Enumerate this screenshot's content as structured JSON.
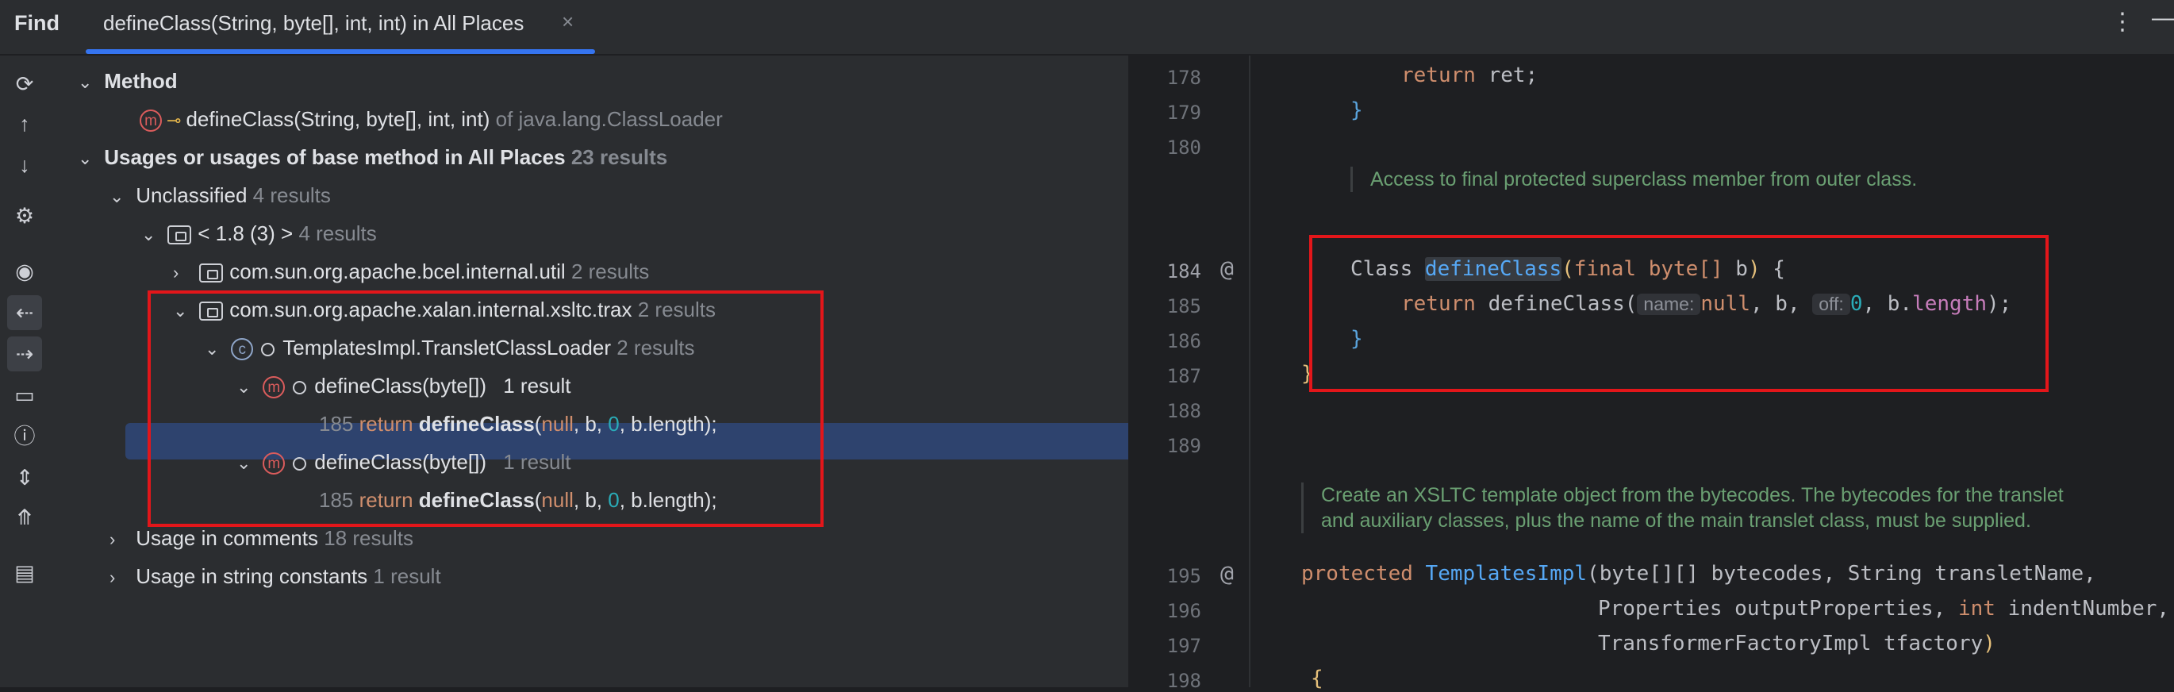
{
  "header": {
    "find_label": "Find",
    "tab_label": "defineClass(String, byte[], int, int) in All Places",
    "close_glyph": "×",
    "more_glyph": "⋮",
    "minimize_glyph": "—"
  },
  "toolbar": {
    "icons": [
      "refresh-icon",
      "arrow-up-icon",
      "arrow-down-icon",
      "settings-icon",
      "preview-icon",
      "merge-left-icon",
      "merge-right-icon",
      "folder-group-icon",
      "info-icon",
      "expand-all-icon",
      "collapse-all-icon",
      "export-icon"
    ]
  },
  "tree": {
    "method_header": "Method",
    "method_signature": "defineClass(String, byte[], int, int)",
    "method_of": "of java.lang.ClassLoader",
    "usages_header": "Usages or usages of base method in All Places",
    "usages_count": "23 results",
    "unclassified_label": "Unclassified",
    "unclassified_count": "4 results",
    "jdk_label": "< 1.8 (3) >",
    "jdk_count": "4 results",
    "pkg1_label": "com.sun.org.apache.bcel.internal.util",
    "pkg1_count": "2 results",
    "pkg2_label": "com.sun.org.apache.xalan.internal.xsltc.trax",
    "pkg2_count": "2 results",
    "class_label": "TemplatesImpl.TransletClassLoader",
    "class_count": "2 results",
    "method1_label": "defineClass(byte[])",
    "method1_count": "1 result",
    "usage1": {
      "line": "185",
      "kw": "return",
      "fn": "defineClass",
      "p1": "(",
      "null": "null",
      "mid": ", b, ",
      "zero": "0",
      "tail": ", b.length);"
    },
    "method2_label": "defineClass(byte[])",
    "method2_count": "1 result",
    "usage2": {
      "line": "185",
      "kw": "return",
      "fn": "defineClass",
      "p1": "(",
      "null": "null",
      "mid": ", b, ",
      "zero": "0",
      "tail": ", b.length);"
    },
    "comments_label": "Usage in comments",
    "comments_count": "18 results",
    "strings_label": "Usage in string constants",
    "strings_count": "1 result"
  },
  "editor": {
    "lines": {
      "l178": "178",
      "l179": "179",
      "l180": "180",
      "l184": "184",
      "l185": "185",
      "l186": "186",
      "l187": "187",
      "l188": "188",
      "l189": "189",
      "l195": "195",
      "l196": "196",
      "l197": "197",
      "l198": "198"
    },
    "code178_kw": "return",
    "code178_rest": " ret;",
    "brace179": "}",
    "doc1": "Access to final protected superclass member from outer class.",
    "code184_cls": "Class ",
    "code184_fn": "defineClass",
    "code184_paren": "(",
    "code184_final": "final",
    "code184_type": " byte",
    "code184_arr": "[]",
    "code184_b": " b",
    "code184_close": ")",
    "code184_brace": " {",
    "code185_kw": "return",
    "code185_fn": " defineClass(",
    "code185_hint1": "name:",
    "code185_null": "null",
    "code185_mid": ", b, ",
    "code185_hint2": "off:",
    "code185_zero": "0",
    "code185_tail1": ", b.",
    "code185_length": "length",
    "code185_tail2": ");",
    "brace186": "}",
    "brace187": "}",
    "doc2_line1": "Create an XSLTC template object from the bytecodes. The bytecodes for the translet",
    "doc2_line2": "and auxiliary classes, plus the name of the main translet class, must be supplied.",
    "code195_kw": "protected",
    "code195_fn": " TemplatesImpl",
    "code195_rest": "(byte[][] bytecodes, String transletName,",
    "code196_pre": "Properties outputProperties, ",
    "code196_kw": "int",
    "code196_rest": " indentNumber,",
    "code197_rest": "TransformerFactoryImpl tfactory",
    "code197_close": ")",
    "code198": "{",
    "gutter_at": "@"
  }
}
